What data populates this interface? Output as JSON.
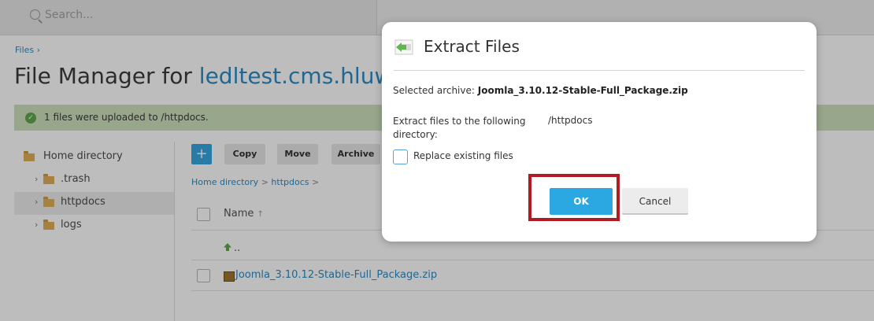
{
  "search": {
    "placeholder": "Search..."
  },
  "breadcrumb": {
    "files": "Files"
  },
  "page": {
    "title_prefix": "File Manager for ",
    "title_domain": "ledltest.cms.hluw"
  },
  "notification": {
    "message": "1 files were uploaded to /httpdocs."
  },
  "sidebar": {
    "items": [
      {
        "label": "Home directory"
      },
      {
        "label": ".trash"
      },
      {
        "label": "httpdocs"
      },
      {
        "label": "logs"
      }
    ]
  },
  "toolbar": {
    "add": "+",
    "copy": "Copy",
    "move": "Move",
    "archive": "Archive"
  },
  "path": {
    "home": "Home directory",
    "sep": ">",
    "current": "httpdocs"
  },
  "file_list": {
    "column_name": "Name",
    "sort_indicator": "↑",
    "parent": "..",
    "files": [
      {
        "name": "Joomla_3.10.12-Stable-Full_Package.zip"
      }
    ]
  },
  "dialog": {
    "title": "Extract Files",
    "selected_archive_label": "Selected archive:",
    "selected_archive_value": "Joomla_3.10.12-Stable-Full_Package.zip",
    "extract_label": "Extract files to the following directory:",
    "extract_value": "/httpdocs",
    "replace_label": "Replace existing files",
    "replace_checked": false,
    "ok_label": "OK",
    "cancel_label": "Cancel"
  },
  "colors": {
    "accent": "#2ba8e2",
    "link": "#2d8cc5",
    "success_bg": "#cde0bc",
    "highlight": "#b11b24"
  },
  "icons": {
    "search": "search-icon",
    "folder": "folder-icon",
    "chevron": "chevron-right-icon",
    "check": "check-circle-icon",
    "extract": "extract-icon",
    "archive": "zip-file-icon",
    "parent": "up-arrow-icon"
  }
}
